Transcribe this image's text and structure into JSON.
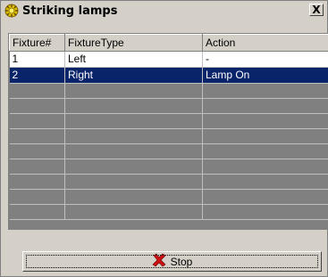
{
  "window": {
    "title": "Striking lamps",
    "close_label": "X"
  },
  "grid": {
    "columns": [
      "Fixture#",
      "FixtureType",
      "Action"
    ],
    "rows": [
      {
        "fixture": "1",
        "type": "Left",
        "action": "-",
        "selected": false
      },
      {
        "fixture": "2",
        "type": "Right",
        "action": "Lamp On",
        "selected": true
      }
    ],
    "empty_rows": 9
  },
  "stop_button": {
    "label": "Stop",
    "icon": "red-x-icon"
  },
  "colors": {
    "selection": "#0a246a",
    "face": "#d4d0c8",
    "empty_area": "#808080"
  }
}
